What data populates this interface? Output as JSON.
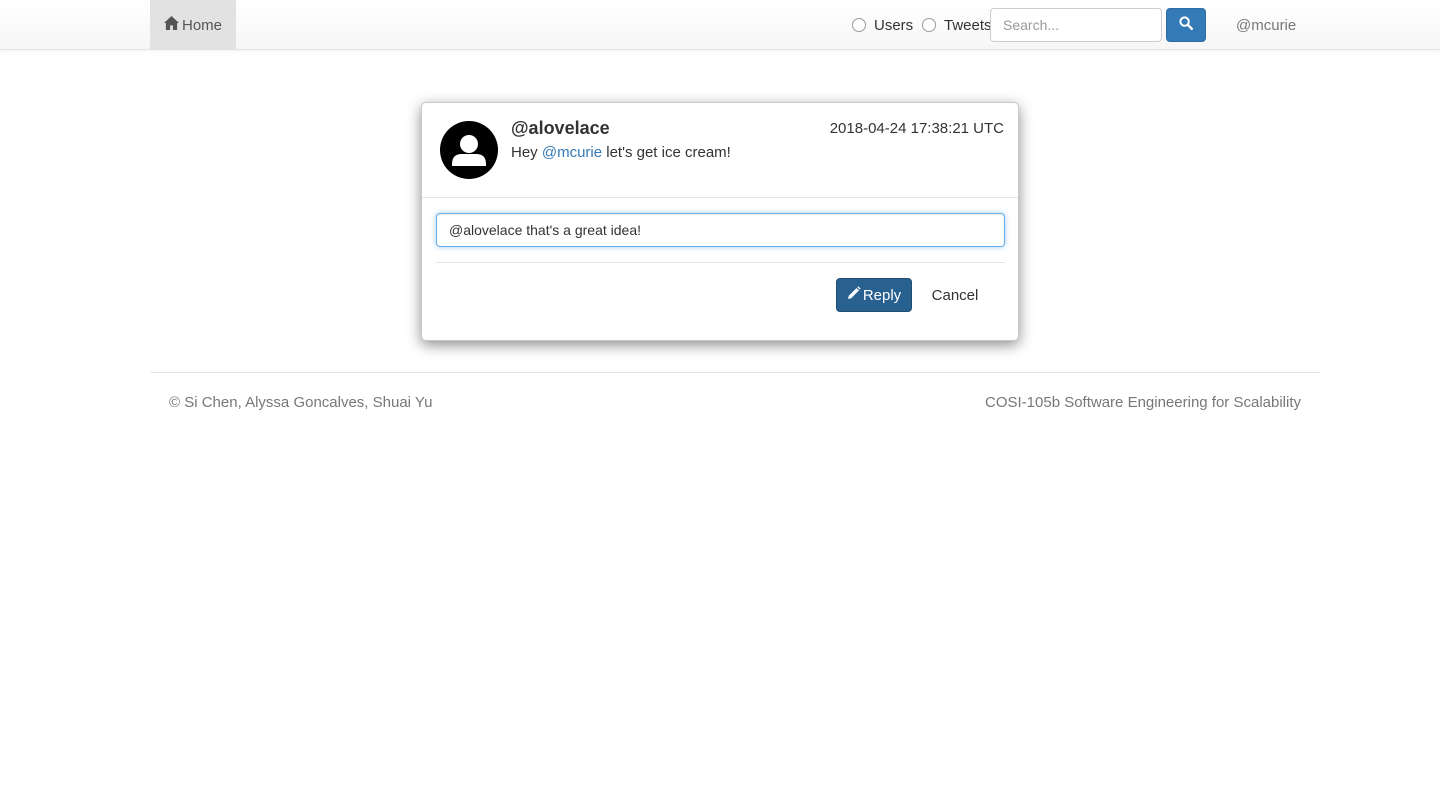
{
  "navbar": {
    "home_label": "Home",
    "search_types": [
      {
        "label": "Users",
        "selected": false
      },
      {
        "label": "Tweets",
        "selected": false
      }
    ],
    "search": {
      "placeholder": "Search...",
      "value": ""
    },
    "current_user": "@mcurie"
  },
  "modal": {
    "author": "@alovelace",
    "timestamp": "2018-04-24 17:38:21 UTC",
    "body_prefix": "Hey ",
    "body_mention": "@mcurie",
    "body_suffix": " let's get ice cream!",
    "reply_value": "@alovelace that's a great idea!",
    "reply_button_label": "Reply",
    "cancel_button_label": "Cancel"
  },
  "footer": {
    "credits": "© Si Chen, Alyssa Goncalves, Shuai Yu",
    "course": "COSI-105b Software Engineering for Scalability"
  },
  "colors": {
    "primary": "#337ab7",
    "primary_dark": "#286090",
    "muted_text": "#777777"
  }
}
